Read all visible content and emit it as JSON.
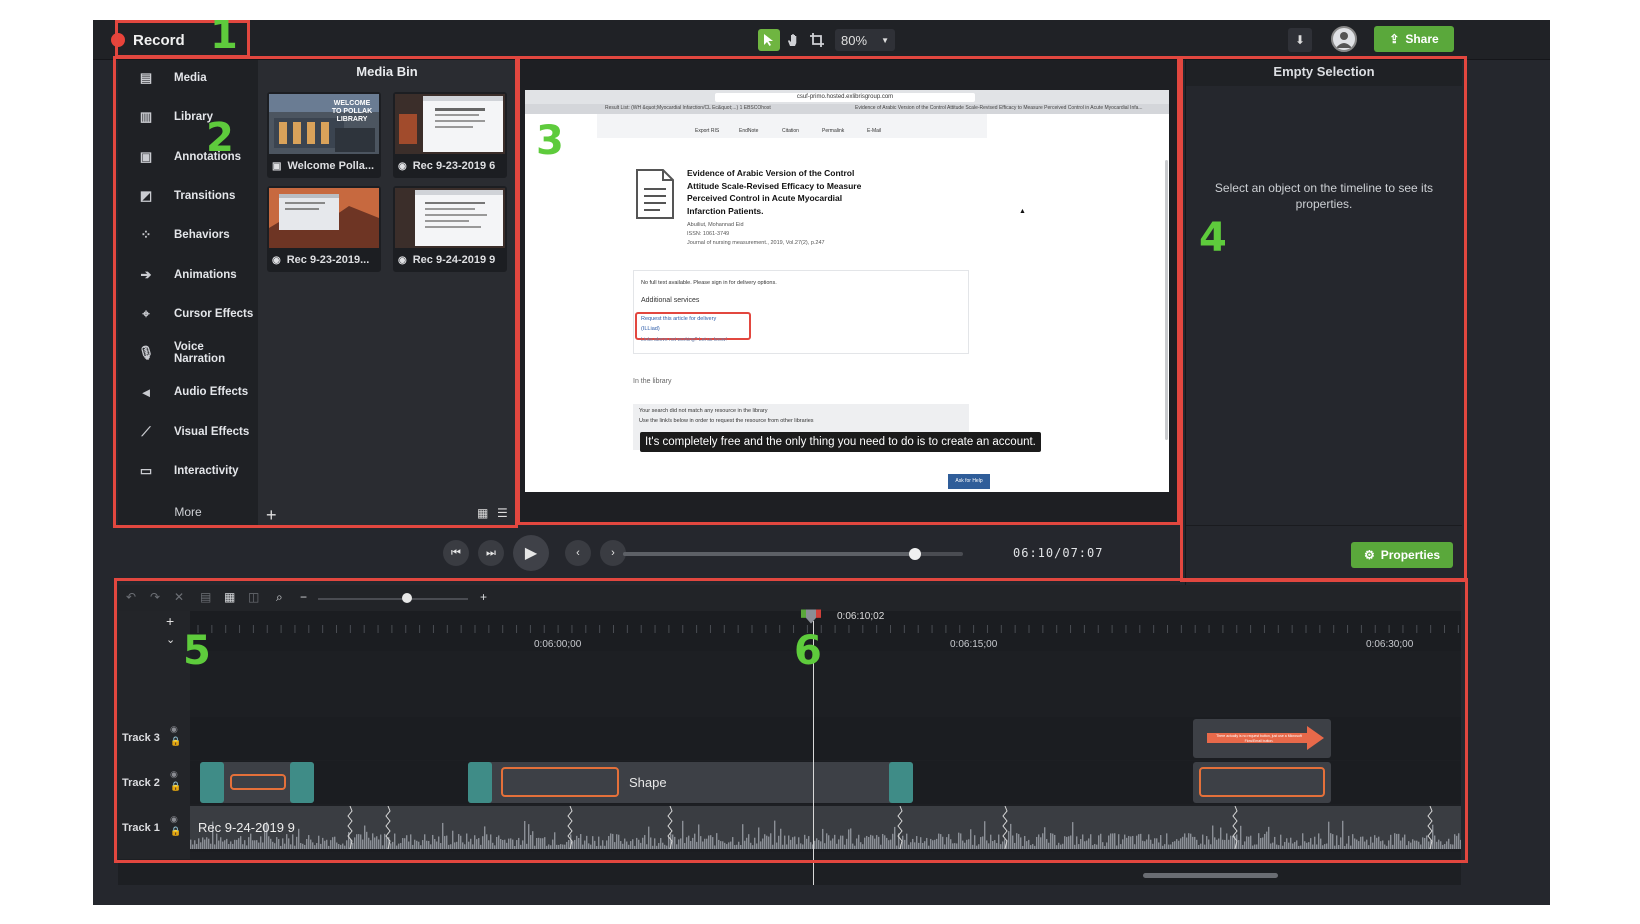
{
  "topbar": {
    "record_label": "Record",
    "zoom_value": "80%",
    "share_label": "Share",
    "icons": [
      "select-arrow-icon",
      "hand-icon",
      "crop-icon",
      "download-icon",
      "avatar-icon",
      "share-icon"
    ]
  },
  "sidebar": {
    "items": [
      {
        "label": "Media",
        "icon": "film-icon"
      },
      {
        "label": "Library",
        "icon": "books-icon"
      },
      {
        "label": "Annotations",
        "icon": "annotation-icon"
      },
      {
        "label": "Transitions",
        "icon": "transition-icon"
      },
      {
        "label": "Behaviors",
        "icon": "behaviors-icon"
      },
      {
        "label": "Animations",
        "icon": "animation-arrow-icon"
      },
      {
        "label": "Cursor Effects",
        "icon": "cursor-icon"
      },
      {
        "label": "Voice Narration",
        "icon": "microphone-icon"
      },
      {
        "label": "Audio Effects",
        "icon": "speaker-icon"
      },
      {
        "label": "Visual Effects",
        "icon": "wand-icon"
      },
      {
        "label": "Interactivity",
        "icon": "interactivity-icon"
      }
    ],
    "more_label": "More"
  },
  "media_bin": {
    "title": "Media Bin",
    "items": [
      {
        "label": "Welcome Polla...",
        "type": "image",
        "thumb_text": "WELCOME TO POLLAK LIBRARY"
      },
      {
        "label": "Rec 9-23-2019 6",
        "type": "recording"
      },
      {
        "label": "Rec 9-23-2019...",
        "type": "recording"
      },
      {
        "label": "Rec 9-24-2019 9",
        "type": "recording"
      }
    ]
  },
  "canvas": {
    "url": "csuf-primo.hosted.exlibrisgroup.com",
    "tab_left": "Result List: (WH &quot;Myocardial Infarction/CL Ec&quot;...) 1 EBSCOhost",
    "tab_right": "Evidence of Arabic Version of the Control Attitude Scale-Revised Efficacy to Measure Perceived Control in Acute Myocardial Infa...",
    "toolbar_items": [
      "Export RIS",
      "EndNote",
      "Citation",
      "Permalink",
      "E-Mail"
    ],
    "article_title": "Evidence of Arabic Version of the Control Attitude Scale-Revised Efficacy to Measure Perceived Control in Acute Myocardial Infarction Patients.",
    "article_author": "Abuiliut, Mohannad Eid",
    "article_issn": "ISSN: 1061-3749",
    "article_journal": "Journal of nursing measurement., 2019, Vol.27(2), p.247",
    "no_fulltext": "No full text available. Please sign in for delivery options.",
    "additional_services": "Additional services",
    "request_link": "Request this article for delivery",
    "illiad": "(ILLiad)",
    "links_note": "Links above not working? Let us know!",
    "in_library": "In the library",
    "search_note_1": "Your search did not match any resource in the library",
    "search_note_2": "Use the link/s below in order to request the resource from other libraries",
    "caption": "It's completely free and the only thing you need to do is to create an account.",
    "ask_help": "Ask for Help"
  },
  "properties": {
    "title": "Empty Selection",
    "message": "Select an object on the timeline to see its properties.",
    "button_label": "Properties"
  },
  "transport": {
    "time": "06:10/07:07",
    "progress_fraction": 0.86
  },
  "timeline": {
    "playhead_time": "0:06:10;02",
    "ruler_labels": [
      "0:06:00;00",
      "0:06:15;00",
      "0:06:30;00"
    ],
    "tracks": [
      {
        "name": "Track 3"
      },
      {
        "name": "Track 2",
        "clip_label": "Shape"
      },
      {
        "name": "Track 1",
        "clip_label": "Rec 9-24-2019 9"
      }
    ],
    "arrow_callout_text": "There actually is no request button, just use a Microsoft Flow/Email button."
  },
  "annotations": [
    "1",
    "2",
    "3",
    "4",
    "5",
    "6"
  ],
  "colors": {
    "accent_green": "#5aa83b",
    "annotation_red": "#e2473f",
    "annotation_number_green": "#5ecb3c",
    "record_red": "#e8433a",
    "clip_teal": "#3f8c87",
    "shape_orange": "#e4703a"
  }
}
